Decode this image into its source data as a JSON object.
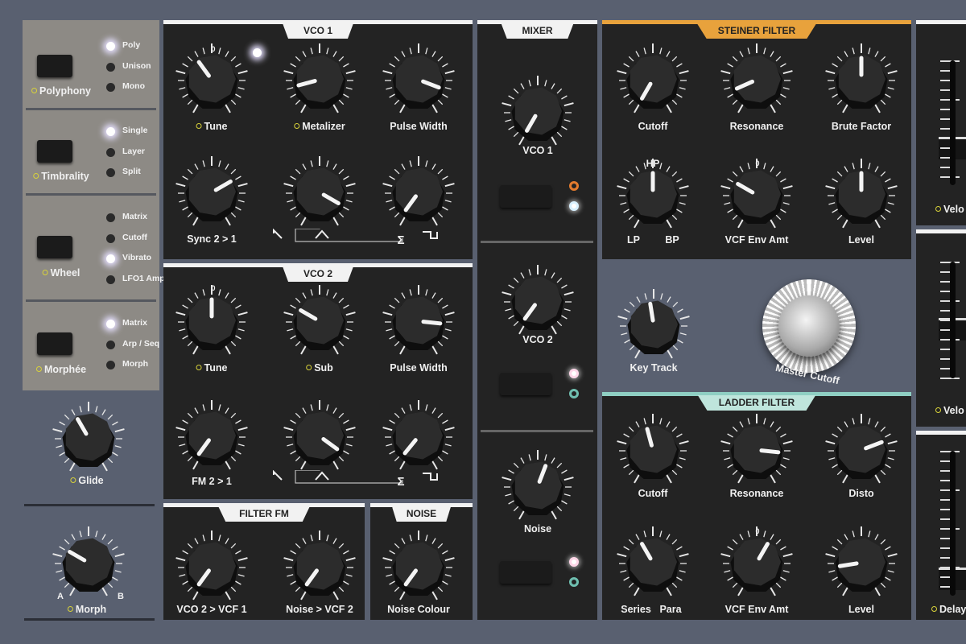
{
  "colors": {
    "panel": "#232323",
    "background": "#596070",
    "steiner_accent": "#e8a23c",
    "ladder_accent": "#8fcfc3",
    "led_ring_orange": "#e37b2e",
    "led_ring_teal": "#6fbfb0"
  },
  "left_panel": {
    "polyphony": {
      "label": "Polyphony",
      "leds": [
        {
          "label": "Poly",
          "on": true
        },
        {
          "label": "Unison",
          "on": false
        },
        {
          "label": "Mono",
          "on": false
        }
      ]
    },
    "timbrality": {
      "label": "Timbrality",
      "leds": [
        {
          "label": "Single",
          "on": true
        },
        {
          "label": "Layer",
          "on": false
        },
        {
          "label": "Split",
          "on": false
        }
      ]
    },
    "wheel": {
      "label": "Wheel",
      "leds": [
        {
          "label": "Matrix",
          "on": false
        },
        {
          "label": "Cutoff",
          "on": false
        },
        {
          "label": "Vibrato",
          "on": true
        },
        {
          "label": "LFO1 Amp",
          "on": false
        }
      ]
    },
    "morphee": {
      "label": "Morphée",
      "leds": [
        {
          "label": "Matrix",
          "on": true
        },
        {
          "label": "Arp / Seq",
          "on": false
        },
        {
          "label": "Morph",
          "on": false
        }
      ]
    },
    "glide": {
      "label": "Glide",
      "value": 0.4
    },
    "morph": {
      "label": "Morph",
      "value": 0.3,
      "a": "A",
      "b": "B"
    }
  },
  "vco1": {
    "title": "VCO 1",
    "zero": "0",
    "knobs": [
      {
        "label": "Tune",
        "value": 0.38
      },
      {
        "label": "Metalizer",
        "value": 0.15
      },
      {
        "label": "Pulse Width",
        "value": 0.87
      },
      {
        "label": "Sync 2 > 1",
        "value": 0.7
      },
      {
        "label": "",
        "value": 0.9
      },
      {
        "label": "",
        "value": 0.02
      }
    ],
    "waves": [
      "saw",
      "triangle",
      "Σ",
      "square"
    ]
  },
  "vco2": {
    "title": "VCO 2",
    "zero": "0",
    "knobs": [
      {
        "label": "Tune",
        "value": 0.5
      },
      {
        "label": "Sub",
        "value": 0.3
      },
      {
        "label": "Pulse Width",
        "value": 0.82
      },
      {
        "label": "FM 2 > 1",
        "value": 0.02
      },
      {
        "label": "",
        "value": 0.92
      },
      {
        "label": "",
        "value": 0.03
      }
    ],
    "waves": [
      "saw",
      "triangle",
      "Σ",
      "square"
    ]
  },
  "filter_fm": {
    "title": "FILTER FM",
    "knobs": [
      {
        "label": "VCO 2 > VCF 1",
        "value": 0.02
      },
      {
        "label": "Noise > VCF 2",
        "value": 0.02
      }
    ]
  },
  "noise": {
    "title": "NOISE",
    "knobs": [
      {
        "label": "Noise Colour",
        "value": 0.02
      }
    ]
  },
  "mixer": {
    "title": "MIXER",
    "channels": [
      {
        "label": "VCO 1",
        "value": 0.0
      },
      {
        "label": "VCO 2",
        "value": 0.02
      },
      {
        "label": "Noise",
        "value": 0.57
      }
    ]
  },
  "steiner": {
    "title": "STEINER FILTER",
    "zero": "0",
    "knobs": [
      {
        "label": "Cutoff",
        "value": 0.0
      },
      {
        "label": "Resonance",
        "value": 0.12
      },
      {
        "label": "Brute Factor",
        "value": 0.5
      },
      {
        "label": "",
        "value": 0.5
      },
      {
        "label": "VCF Env Amt",
        "value": 0.3
      },
      {
        "label": "Level",
        "value": 0.5
      }
    ],
    "mode": {
      "hp": "HP",
      "lp": "LP",
      "bp": "BP"
    }
  },
  "key_track": {
    "label": "Key Track",
    "value": 0.47
  },
  "master_cutoff": {
    "label": "Master Cutoff"
  },
  "ladder": {
    "title": "LADDER FILTER",
    "zero": "0",
    "knobs": [
      {
        "label": "Cutoff",
        "value": 0.45
      },
      {
        "label": "Resonance",
        "value": 0.82
      },
      {
        "label": "Disto",
        "value": 0.73
      },
      {
        "label": "",
        "value": 0.4
      },
      {
        "label": "VCF Env Amt",
        "value": 0.6
      },
      {
        "label": "Level",
        "value": 0.17
      }
    ],
    "series": "Series",
    "para": "Para"
  },
  "right": {
    "labels": [
      "Velo",
      "Velo",
      "Delay"
    ]
  }
}
